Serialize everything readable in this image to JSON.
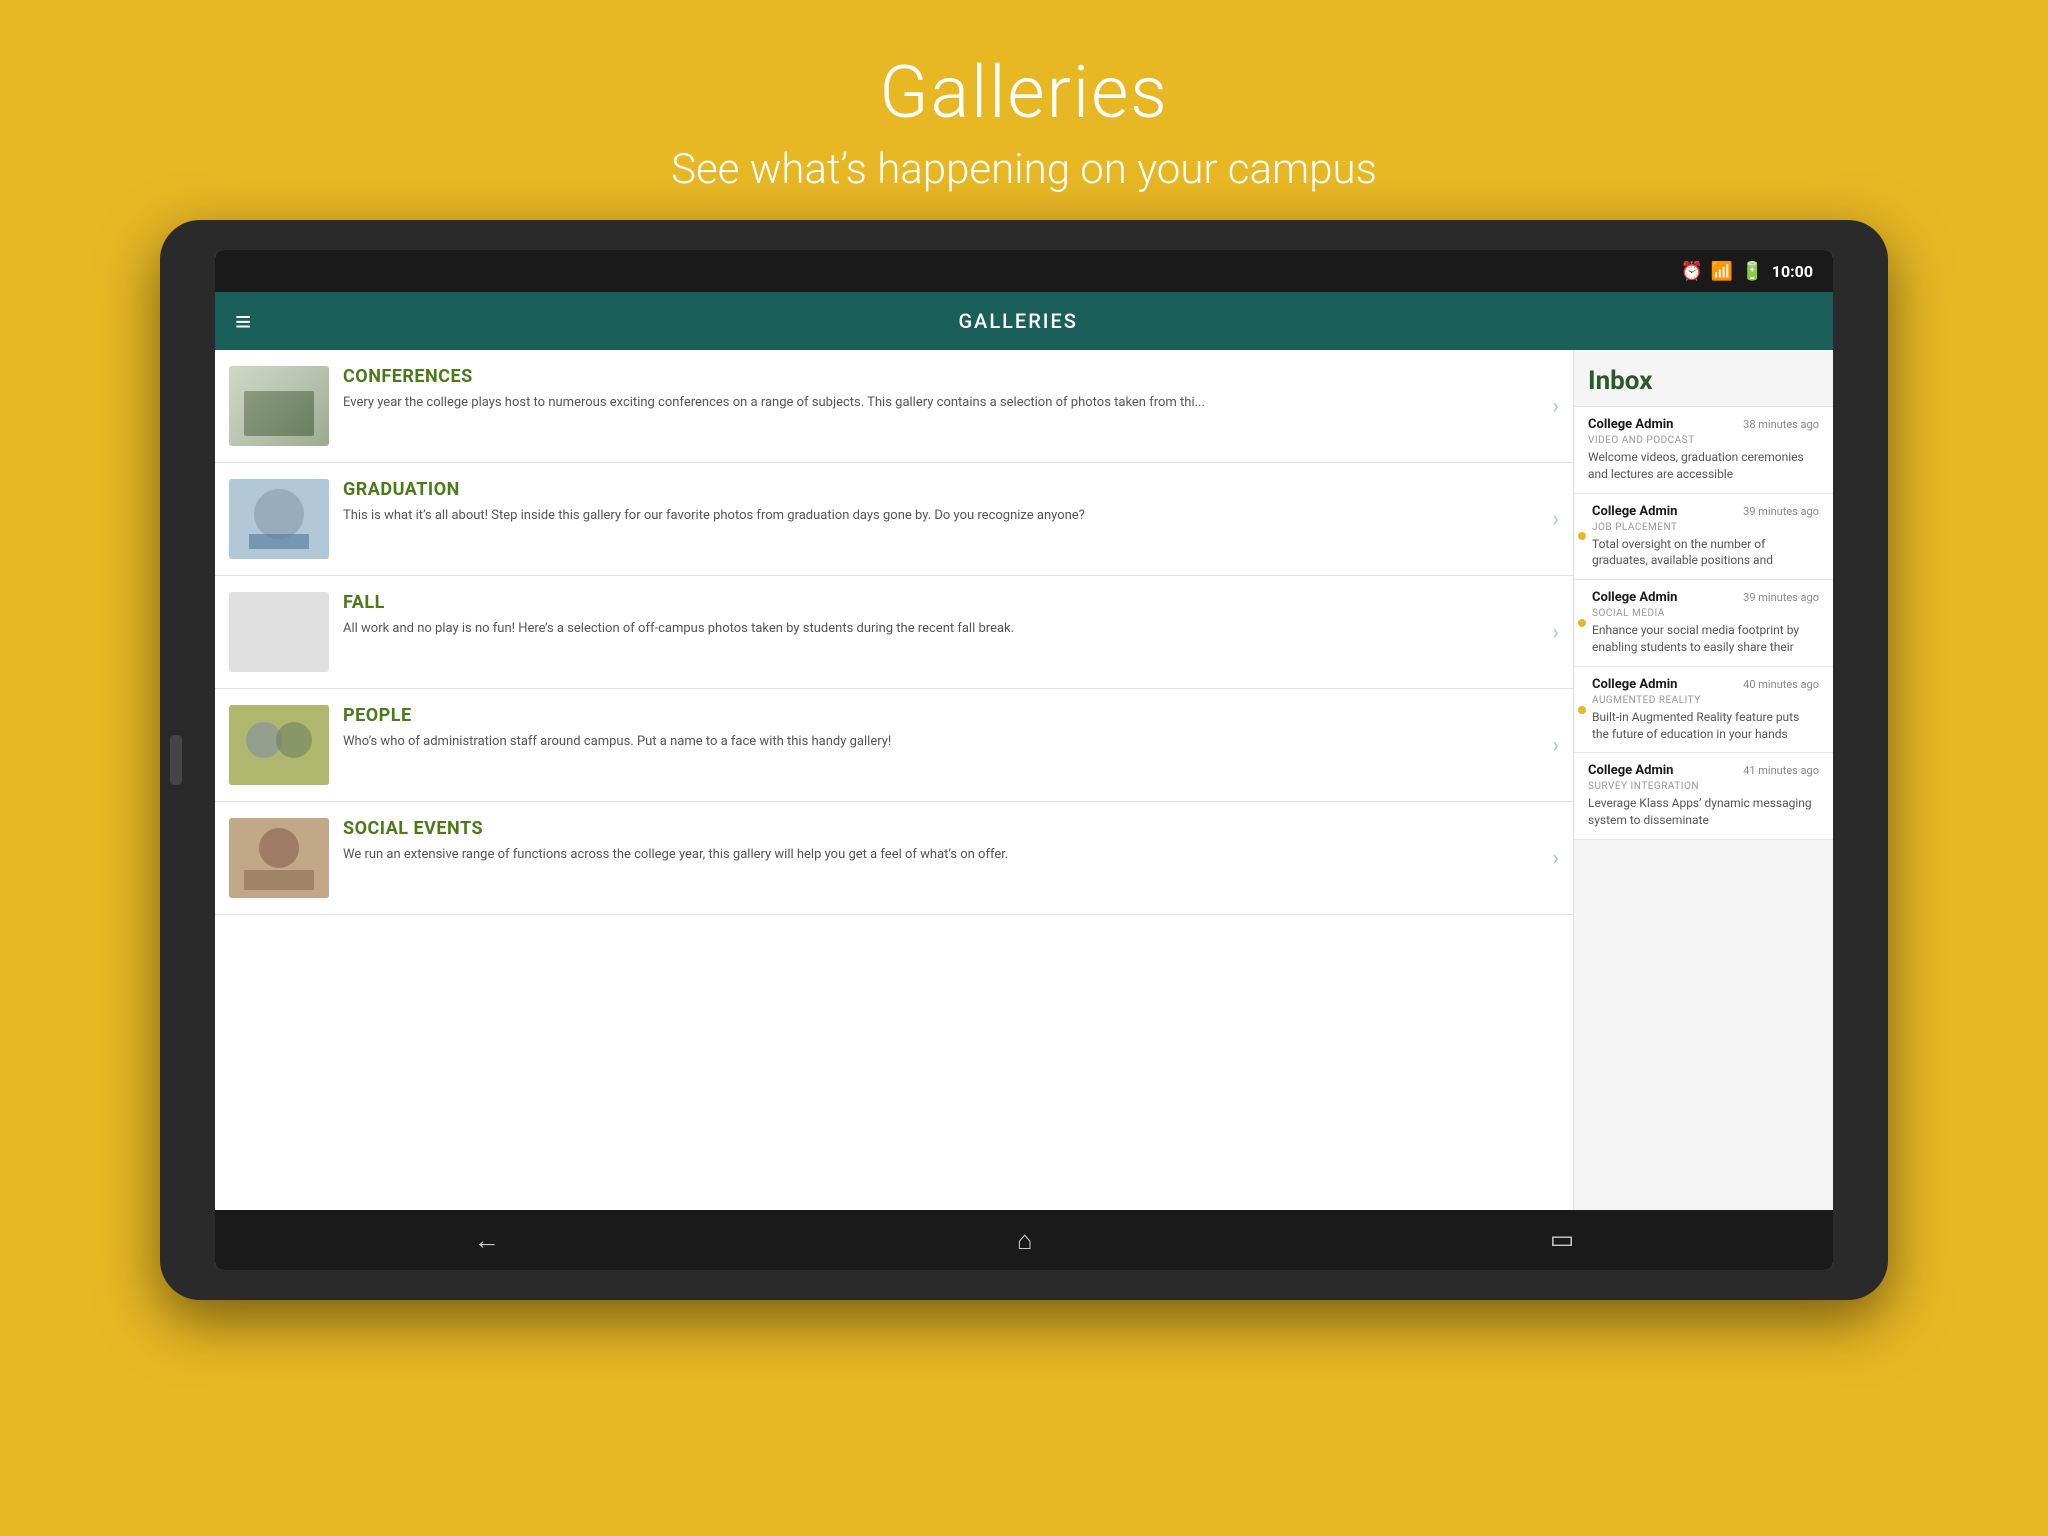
{
  "page": {
    "background_color": "#E8B824",
    "title": "Galleries",
    "subtitle": "See what’s happening on your campus"
  },
  "status_bar": {
    "time": "10:00",
    "icons": [
      "alarm-icon",
      "wifi-icon",
      "battery-icon"
    ]
  },
  "app_bar": {
    "title": "GALLERIES",
    "menu_icon": "≡"
  },
  "gallery_items": [
    {
      "id": "conferences",
      "title": "CONFERENCES",
      "description": "Every year the college plays host to numerous exciting conferences on a range of subjects.  This gallery contains a selection of photos taken from thi...",
      "thumb_class": "thumb-conferences"
    },
    {
      "id": "graduation",
      "title": "GRADUATION",
      "description": "This is what it’s all about!  Step inside this gallery for our favorite photos from graduation days gone by.  Do you recognize anyone?",
      "thumb_class": "thumb-graduation"
    },
    {
      "id": "fall",
      "title": "FALL",
      "description": "All work and no play is no fun!  Here’s a selection of off-campus photos taken by students during the recent fall break.",
      "thumb_class": "thumb-fall"
    },
    {
      "id": "people",
      "title": "PEOPLE",
      "description": "Who’s who of administration staff around campus.  Put a name to a face with this handy gallery!",
      "thumb_class": "thumb-people"
    },
    {
      "id": "social-events",
      "title": "SOCIAL EVENTS",
      "description": "We run an extensive range of functions across the college year, this gallery will help you get a feel of what’s on offer.",
      "thumb_class": "thumb-social"
    }
  ],
  "inbox": {
    "title": "Inbox",
    "items": [
      {
        "sender": "College Admin",
        "time": "38 minutes ago",
        "category": "VIDEO AND PODCAST",
        "preview": "Welcome videos, graduation ceremonies and lectures are accessible",
        "unread": false
      },
      {
        "sender": "College Admin",
        "time": "39 minutes ago",
        "category": "JOB PLACEMENT",
        "preview": "Total oversight on the number of graduates, available positions and",
        "unread": true
      },
      {
        "sender": "College Admin",
        "time": "39 minutes ago",
        "category": "SOCIAL MEDIA",
        "preview": "Enhance your social media footprint by enabling students to easily share their",
        "unread": true
      },
      {
        "sender": "College Admin",
        "time": "40 minutes ago",
        "category": "AUGMENTED REALITY",
        "preview": "Built-in Augmented Reality feature puts the future of education in your hands",
        "unread": true
      },
      {
        "sender": "College Admin",
        "time": "41 minutes ago",
        "category": "SURVEY INTEGRATION",
        "preview": "Leverage Klass Apps’ dynamic messaging system to disseminate",
        "unread": false
      }
    ]
  },
  "bottom_nav": {
    "back_icon": "←",
    "home_icon": "⌂",
    "recent_icon": "□"
  }
}
